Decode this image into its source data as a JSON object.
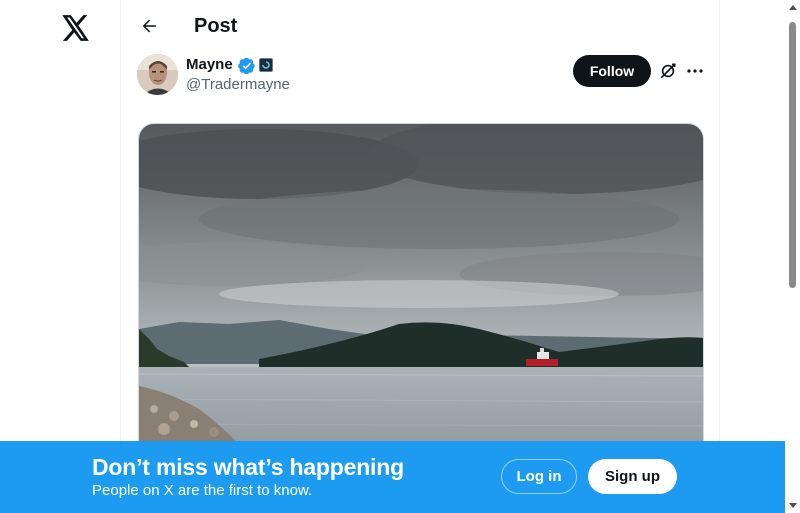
{
  "nav": {
    "logo_icon": "x-logo-icon"
  },
  "header": {
    "title": "Post",
    "back_icon": "arrow-left-icon"
  },
  "author": {
    "name": "Mayne",
    "handle": "@Tradermayne",
    "verified_icon": "verified-badge-icon",
    "affiliate_icon": "affiliate-badge-icon"
  },
  "actions": {
    "follow_label": "Follow",
    "grok_icon": "grok-icon",
    "more_icon": "more-icon"
  },
  "post": {
    "media_icon": "photo-landscape-lake-icon"
  },
  "banner": {
    "title": "Don’t miss what’s happening",
    "subtitle": "People on X are the first to know.",
    "login_label": "Log in",
    "signup_label": "Sign up"
  },
  "colors": {
    "accent": "#1d9bf0",
    "text": "#0f1419",
    "secondary_text": "#536471",
    "follow_bg": "#0f1419"
  }
}
